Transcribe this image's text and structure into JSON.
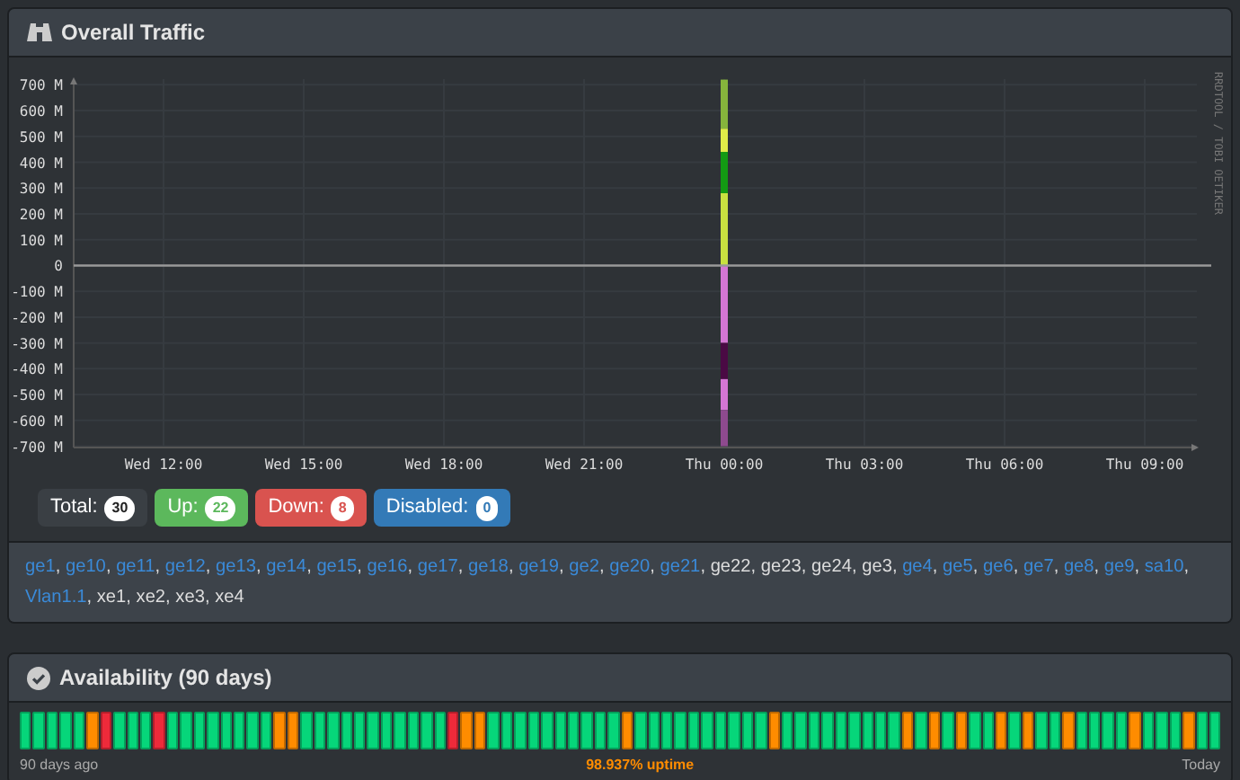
{
  "traffic_panel": {
    "title": "Overall Traffic",
    "chart_data": {
      "type": "bar",
      "stacked": true,
      "grid": true,
      "categories": [
        "Wed 12:00",
        "Wed 15:00",
        "Wed 18:00",
        "Wed 21:00",
        "Thu 00:00",
        "Thu 03:00",
        "Thu 06:00",
        "Thu 09:00"
      ],
      "ylim": [
        -705,
        722
      ],
      "yticks": [
        {
          "value": 700,
          "label": "700 M"
        },
        {
          "value": 600,
          "label": "600 M"
        },
        {
          "value": 500,
          "label": "500 M"
        },
        {
          "value": 400,
          "label": "400 M"
        },
        {
          "value": 300,
          "label": "300 M"
        },
        {
          "value": 200,
          "label": "200 M"
        },
        {
          "value": 100,
          "label": "100 M"
        },
        {
          "value": 0,
          "label": "0"
        },
        {
          "value": -100,
          "label": "-100 M"
        },
        {
          "value": -200,
          "label": "-200 M"
        },
        {
          "value": -300,
          "label": "-300 M"
        },
        {
          "value": -400,
          "label": "-400 M"
        },
        {
          "value": -500,
          "label": "-500 M"
        },
        {
          "value": -600,
          "label": "-600 M"
        },
        {
          "value": -700,
          "label": "-700 M"
        }
      ],
      "series": [
        {
          "color": "#c8e040",
          "values": [
            null,
            null,
            null,
            null,
            280,
            null,
            null,
            null
          ]
        },
        {
          "color": "#139a13",
          "values": [
            null,
            null,
            null,
            null,
            160,
            null,
            null,
            null
          ]
        },
        {
          "color": "#e0ec48",
          "values": [
            null,
            null,
            null,
            null,
            90,
            null,
            null,
            null
          ]
        },
        {
          "color": "#86b43c",
          "values": [
            null,
            null,
            null,
            null,
            190,
            null,
            null,
            null
          ]
        },
        {
          "color": "#d476d4",
          "values": [
            null,
            null,
            null,
            null,
            -300,
            null,
            null,
            null
          ]
        },
        {
          "color": "#4a0a44",
          "values": [
            null,
            null,
            null,
            null,
            -140,
            null,
            null,
            null
          ]
        },
        {
          "color": "#d476d4",
          "values": [
            null,
            null,
            null,
            null,
            -120,
            null,
            null,
            null
          ]
        },
        {
          "color": "#8e4a8e",
          "values": [
            null,
            null,
            null,
            null,
            -140,
            null,
            null,
            null
          ]
        }
      ]
    },
    "credit": "RRDTOOL / TOBI OETIKER",
    "counts": [
      {
        "kind": "total",
        "label": "Total:",
        "count": "30"
      },
      {
        "kind": "up",
        "label": "Up:",
        "count": "22"
      },
      {
        "kind": "down",
        "label": "Down:",
        "count": "8"
      },
      {
        "kind": "disabled",
        "label": "Disabled:",
        "count": "0"
      }
    ],
    "port_separator": ",",
    "ports": [
      {
        "name": "ge1",
        "linked": true
      },
      {
        "name": "ge10",
        "linked": true
      },
      {
        "name": "ge11",
        "linked": true
      },
      {
        "name": "ge12",
        "linked": true
      },
      {
        "name": "ge13",
        "linked": true
      },
      {
        "name": "ge14",
        "linked": true
      },
      {
        "name": "ge15",
        "linked": true
      },
      {
        "name": "ge16",
        "linked": true
      },
      {
        "name": "ge17",
        "linked": true
      },
      {
        "name": "ge18",
        "linked": true
      },
      {
        "name": "ge19",
        "linked": true
      },
      {
        "name": "ge2",
        "linked": true
      },
      {
        "name": "ge20",
        "linked": true
      },
      {
        "name": "ge21",
        "linked": true
      },
      {
        "name": "ge22",
        "linked": false
      },
      {
        "name": "ge23",
        "linked": false
      },
      {
        "name": "ge24",
        "linked": false
      },
      {
        "name": "ge3",
        "linked": false
      },
      {
        "name": "ge4",
        "linked": true
      },
      {
        "name": "ge5",
        "linked": true
      },
      {
        "name": "ge6",
        "linked": true
      },
      {
        "name": "ge7",
        "linked": true
      },
      {
        "name": "ge8",
        "linked": true
      },
      {
        "name": "ge9",
        "linked": true
      },
      {
        "name": "sa10",
        "linked": true
      },
      {
        "name": "Vlan1.1",
        "linked": true
      },
      {
        "name": "xe1",
        "linked": false
      },
      {
        "name": "xe2",
        "linked": false
      },
      {
        "name": "xe3",
        "linked": false
      },
      {
        "name": "xe4",
        "linked": false
      }
    ]
  },
  "availability_panel": {
    "title": "Availability (90 days)",
    "days": [
      {
        "color": "#06d67a"
      },
      {
        "color": "#06d67a"
      },
      {
        "color": "#06d67a"
      },
      {
        "color": "#06d67a"
      },
      {
        "color": "#06d67a"
      },
      {
        "color": "#ff8c00"
      },
      {
        "color": "#ee2a3a"
      },
      {
        "color": "#06d67a"
      },
      {
        "color": "#06d67a"
      },
      {
        "color": "#06d67a"
      },
      {
        "color": "#ee2a3a"
      },
      {
        "color": "#06d67a"
      },
      {
        "color": "#06d67a"
      },
      {
        "color": "#06d67a"
      },
      {
        "color": "#06d67a"
      },
      {
        "color": "#06d67a"
      },
      {
        "color": "#06d67a"
      },
      {
        "color": "#06d67a"
      },
      {
        "color": "#06d67a"
      },
      {
        "color": "#ff8c00"
      },
      {
        "color": "#ff8c00"
      },
      {
        "color": "#06d67a"
      },
      {
        "color": "#06d67a"
      },
      {
        "color": "#06d67a"
      },
      {
        "color": "#06d67a"
      },
      {
        "color": "#06d67a"
      },
      {
        "color": "#06d67a"
      },
      {
        "color": "#06d67a"
      },
      {
        "color": "#06d67a"
      },
      {
        "color": "#06d67a"
      },
      {
        "color": "#06d67a"
      },
      {
        "color": "#06d67a"
      },
      {
        "color": "#ee2a3a"
      },
      {
        "color": "#ff8c00"
      },
      {
        "color": "#ff8c00"
      },
      {
        "color": "#06d67a"
      },
      {
        "color": "#06d67a"
      },
      {
        "color": "#06d67a"
      },
      {
        "color": "#06d67a"
      },
      {
        "color": "#06d67a"
      },
      {
        "color": "#06d67a"
      },
      {
        "color": "#06d67a"
      },
      {
        "color": "#06d67a"
      },
      {
        "color": "#06d67a"
      },
      {
        "color": "#06d67a"
      },
      {
        "color": "#ff8c00"
      },
      {
        "color": "#06d67a"
      },
      {
        "color": "#06d67a"
      },
      {
        "color": "#06d67a"
      },
      {
        "color": "#06d67a"
      },
      {
        "color": "#06d67a"
      },
      {
        "color": "#06d67a"
      },
      {
        "color": "#06d67a"
      },
      {
        "color": "#06d67a"
      },
      {
        "color": "#06d67a"
      },
      {
        "color": "#06d67a"
      },
      {
        "color": "#ff8c00"
      },
      {
        "color": "#06d67a"
      },
      {
        "color": "#06d67a"
      },
      {
        "color": "#06d67a"
      },
      {
        "color": "#06d67a"
      },
      {
        "color": "#06d67a"
      },
      {
        "color": "#06d67a"
      },
      {
        "color": "#06d67a"
      },
      {
        "color": "#06d67a"
      },
      {
        "color": "#06d67a"
      },
      {
        "color": "#ff8c00"
      },
      {
        "color": "#06d67a"
      },
      {
        "color": "#ff8c00"
      },
      {
        "color": "#06d67a"
      },
      {
        "color": "#ff8c00"
      },
      {
        "color": "#06d67a"
      },
      {
        "color": "#06d67a"
      },
      {
        "color": "#ff8c00"
      },
      {
        "color": "#06d67a"
      },
      {
        "color": "#ff8c00"
      },
      {
        "color": "#06d67a"
      },
      {
        "color": "#06d67a"
      },
      {
        "color": "#ff8c00"
      },
      {
        "color": "#06d67a"
      },
      {
        "color": "#06d67a"
      },
      {
        "color": "#06d67a"
      },
      {
        "color": "#06d67a"
      },
      {
        "color": "#ff8c00"
      },
      {
        "color": "#06d67a"
      },
      {
        "color": "#06d67a"
      },
      {
        "color": "#06d67a"
      },
      {
        "color": "#ff8c00"
      },
      {
        "color": "#06d67a"
      },
      {
        "color": "#06d67a"
      }
    ],
    "start_label": "90 days ago",
    "uptime": "98.937% uptime",
    "end_label": "Today"
  }
}
